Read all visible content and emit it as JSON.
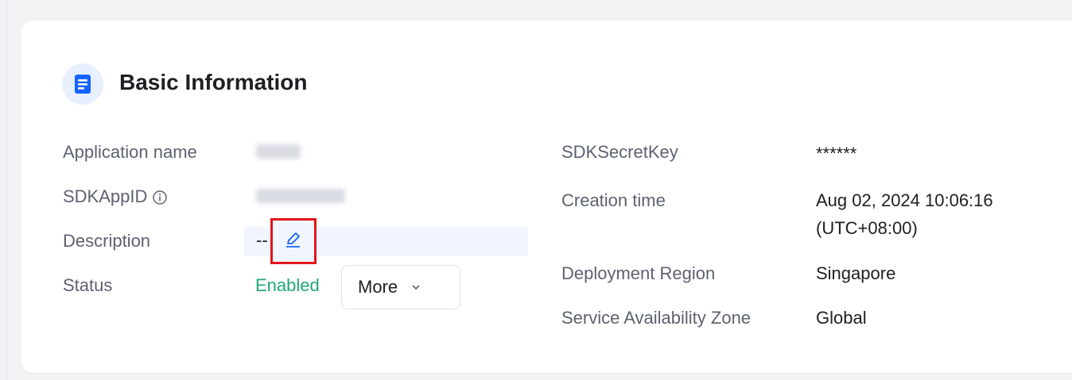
{
  "section": {
    "title": "Basic Information",
    "icon": "document-icon"
  },
  "left": {
    "app_name_label": "Application name",
    "sdkappid_label": "SDKAppID",
    "description_label": "Description",
    "description_value": "--",
    "status_label": "Status",
    "status_value": "Enabled",
    "more_button": "More"
  },
  "right": {
    "secret_label": "SDKSecretKey",
    "secret_value": "******",
    "creation_label": "Creation time",
    "creation_value_line1": "Aug 02, 2024 10:06:16",
    "creation_value_line2": "(UTC+08:00)",
    "region_label": "Deployment Region",
    "region_value": "Singapore",
    "zone_label": "Service Availability Zone",
    "zone_value": "Global"
  },
  "colors": {
    "accent": "#1664ff",
    "enabled": "#22a876",
    "highlight_box": "#e2161a"
  }
}
